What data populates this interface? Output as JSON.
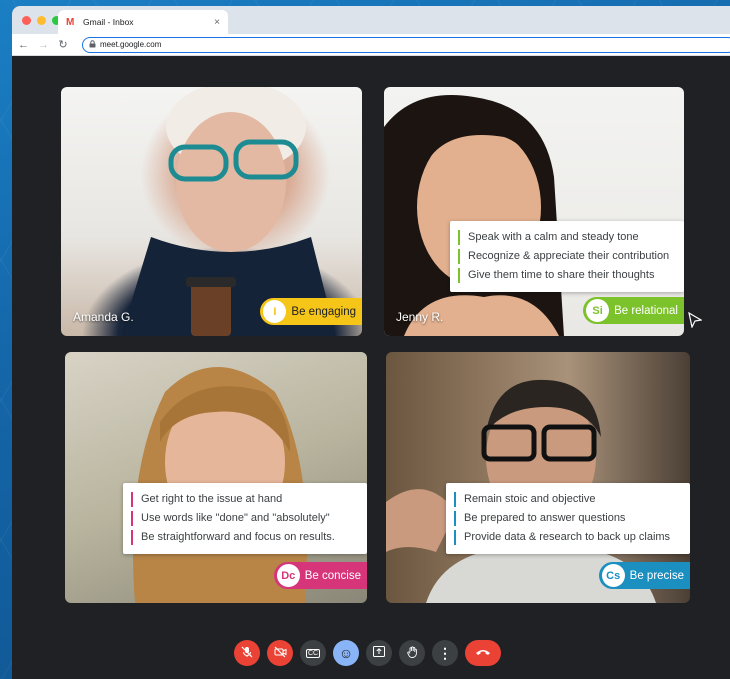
{
  "browser": {
    "tab_title": "Gmail - Inbox",
    "tab_icon": "M",
    "url": "meet.google.com",
    "nav": {
      "back": "←",
      "forward": "→",
      "reload": "↻",
      "close": "×"
    }
  },
  "participants": [
    {
      "name": "Amanda G.",
      "badge": {
        "initials": "I",
        "label": "Be engaging",
        "color": "#f5c518"
      },
      "tips": []
    },
    {
      "name": "Jenny R.",
      "badge": {
        "initials": "Si",
        "label": "Be relational",
        "color": "#7cc22b"
      },
      "tips": [
        "Speak with a calm and steady tone",
        "Recognize & appreciate their contribution",
        "Give them time to share their thoughts"
      ]
    },
    {
      "name": "",
      "badge": {
        "initials": "Dc",
        "label": "Be concise",
        "color": "#d6357a"
      },
      "tips": [
        "Get right to the issue at hand",
        "Use words like \"done\" and \"absolutely\"",
        "Be straightforward and focus on results."
      ]
    },
    {
      "name": "",
      "badge": {
        "initials": "Cs",
        "label": "Be precise",
        "color": "#1a8fc0"
      },
      "tips": [
        "Remain stoic and objective",
        "Be prepared to answer questions",
        "Provide data & research to back up claims"
      ]
    }
  ],
  "toolbar": {
    "mic": "mic-off-icon",
    "camera": "camera-off-icon",
    "captions": "CC",
    "emoji": "☺",
    "present": "present-icon",
    "hand": "hand-icon",
    "more": "⋮",
    "hangup": "hangup-icon"
  }
}
